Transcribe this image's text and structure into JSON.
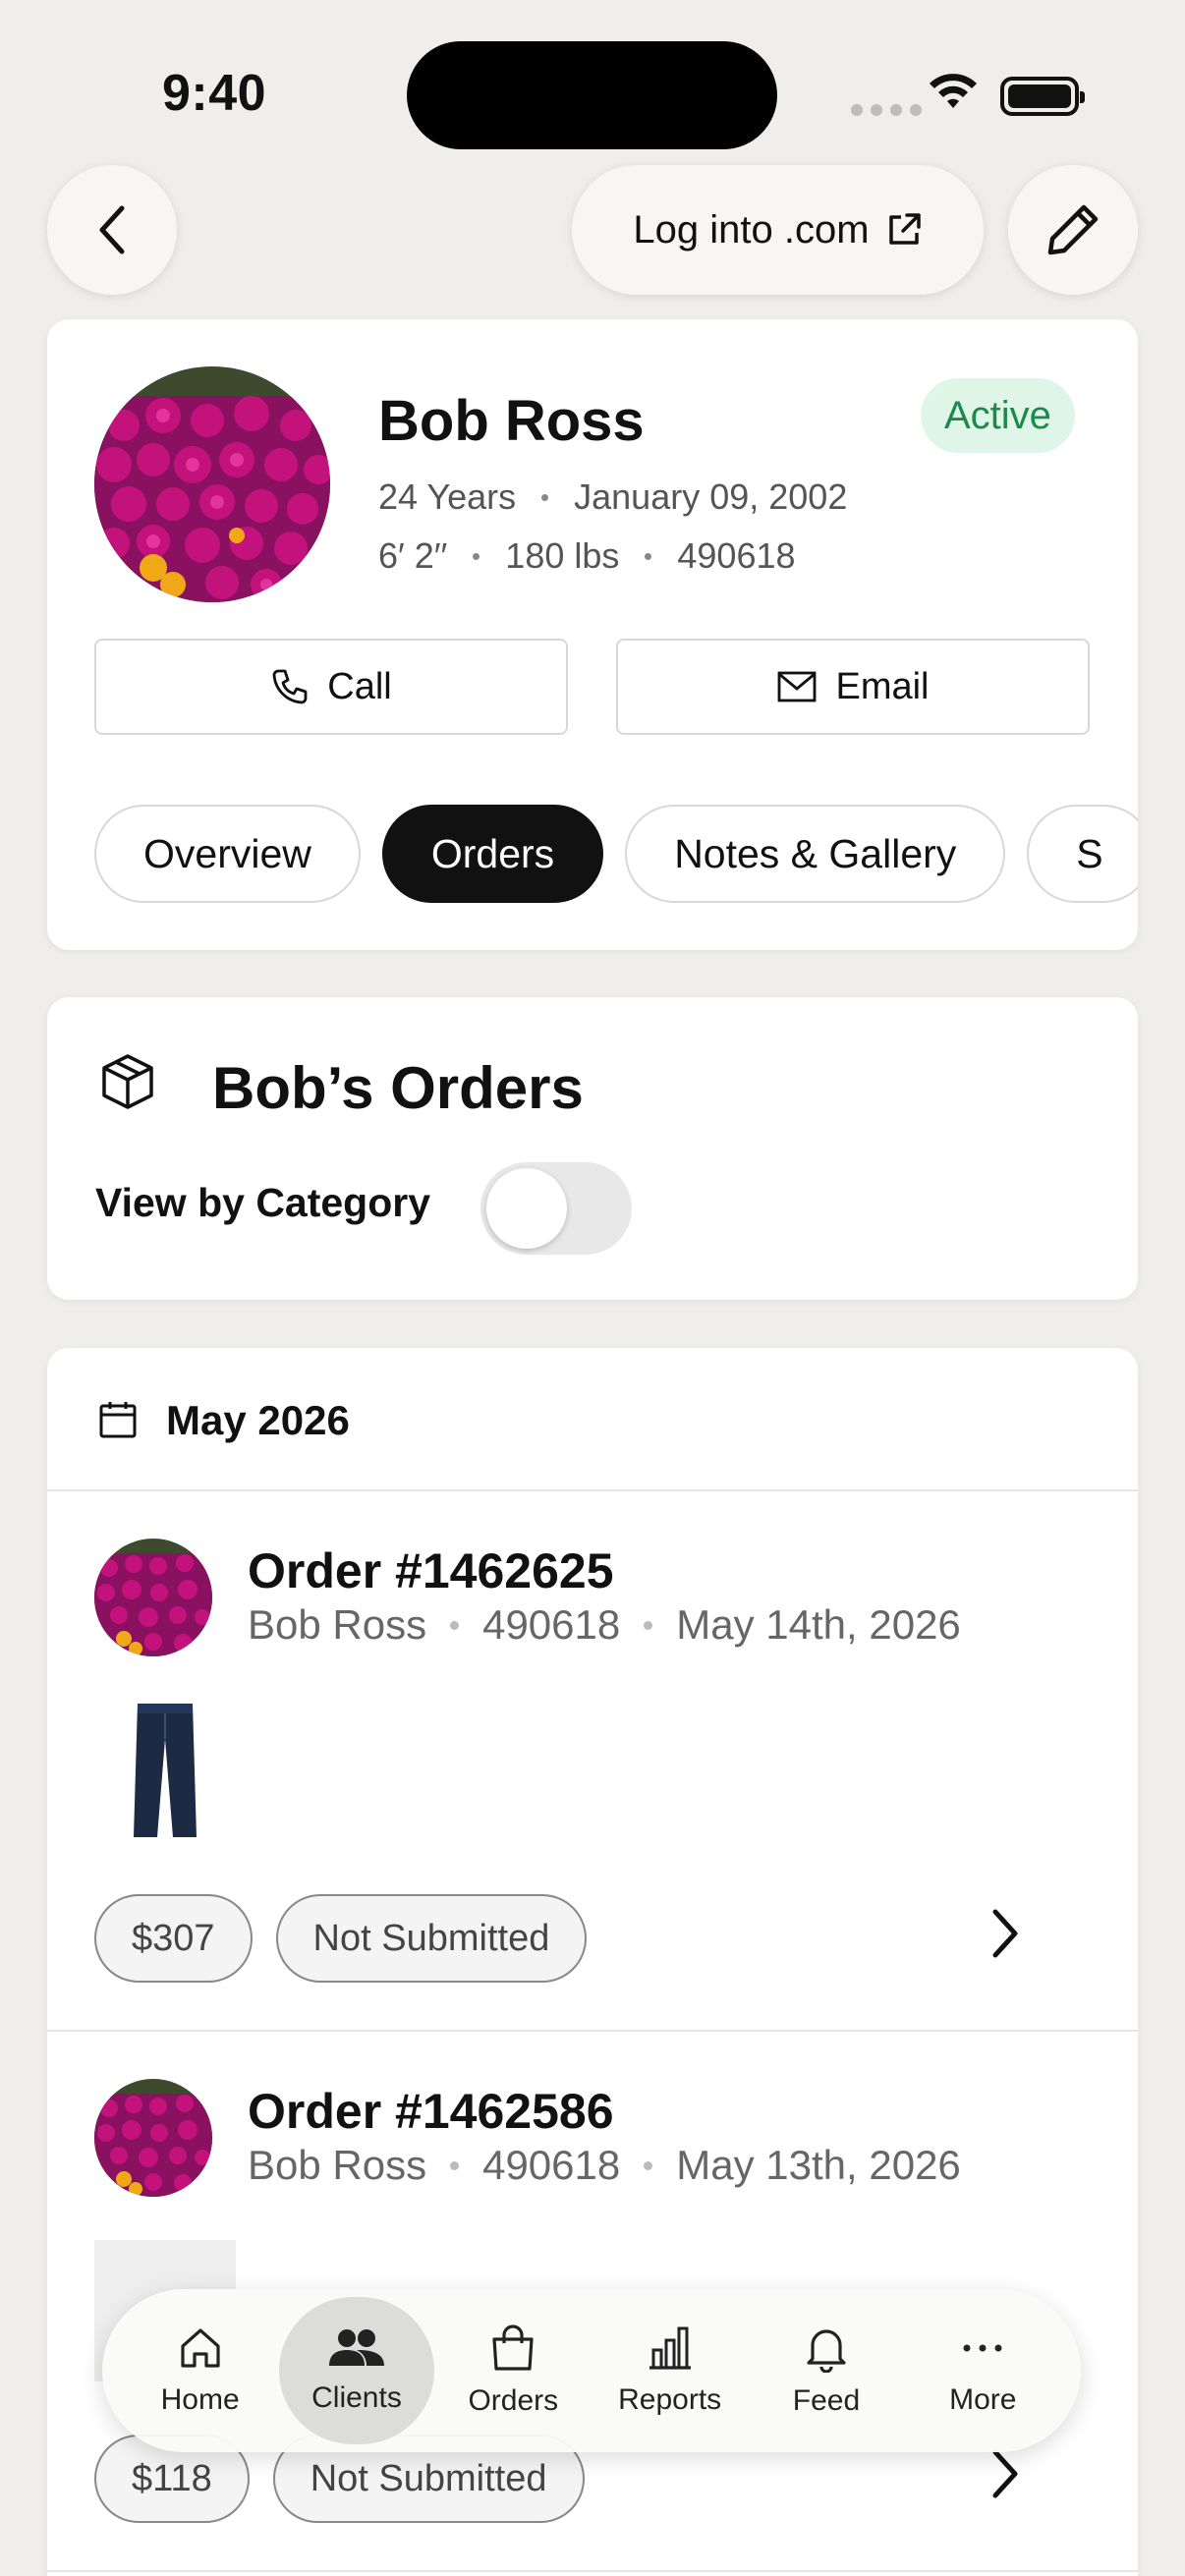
{
  "status_bar": {
    "time": "9:40"
  },
  "top_nav": {
    "login_label": "Log into .com"
  },
  "profile": {
    "name": "Bob Ross",
    "status": "Active",
    "age": "24 Years",
    "birthdate": "January 09, 2002",
    "height": "6′ 2′′",
    "weight": "180 lbs",
    "client_id": "490618",
    "call_label": "Call",
    "email_label": "Email",
    "tabs": [
      {
        "label": "Overview",
        "active": false
      },
      {
        "label": "Orders",
        "active": true
      },
      {
        "label": "Notes & Gallery",
        "active": false
      },
      {
        "label": "S",
        "active": false
      }
    ]
  },
  "orders_section": {
    "title": "Bob’s Orders",
    "toggle_label": "View by Category",
    "toggle_on": false,
    "month": "May 2026",
    "orders": [
      {
        "title": "Order #1462625",
        "client": "Bob Ross",
        "client_id": "490618",
        "date": "May 14th, 2026",
        "amount": "$307",
        "status": "Not Submitted"
      },
      {
        "title": "Order #1462586",
        "client": "Bob Ross",
        "client_id": "490618",
        "date": "May 13th, 2026",
        "amount": "$118",
        "status": "Not Submitted"
      }
    ]
  },
  "tabbar": {
    "items": [
      {
        "label": "Home",
        "icon": "home-icon",
        "active": false
      },
      {
        "label": "Clients",
        "icon": "clients-icon",
        "active": true
      },
      {
        "label": "Orders",
        "icon": "bag-icon",
        "active": false
      },
      {
        "label": "Reports",
        "icon": "chart-icon",
        "active": false
      },
      {
        "label": "Feed",
        "icon": "bell-icon",
        "active": false
      },
      {
        "label": "More",
        "icon": "more-icon",
        "active": false
      }
    ]
  },
  "colors": {
    "accent": "#111111",
    "active_badge_bg": "#dff5e7",
    "active_badge_text": "#1c8a4a"
  }
}
